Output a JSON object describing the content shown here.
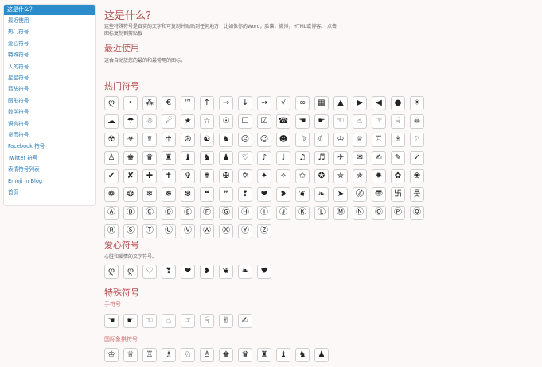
{
  "sidebar": {
    "active": "这是什么？",
    "nav": [
      "最近使用",
      "热门符号",
      "爱心符号",
      "特殊符号",
      "人的符号",
      "星星符号",
      "箭头符号",
      "图形符号",
      "数学符号",
      "语言符号",
      "货币符号"
    ],
    "social": [
      "Facebook 符号",
      "Twitter 符号",
      "表情符号列表",
      "Emoji in Blog",
      "首页"
    ]
  },
  "main": {
    "title": "这是什么？",
    "intro": [
      "这些特殊符号是真实的文字和可复制并贴贴到任何地方，比如像你的Word，脸谱，微博，HTML或博客。 点击",
      "图标复制到剪贴板"
    ],
    "recent": {
      "heading": "最近使用",
      "desc": "这会自动放您的最的和最常用的图标。"
    },
    "hot": {
      "heading": "热门符号",
      "symbols": [
        "ღ",
        "•",
        "⁂",
        "€",
        "™",
        "↑",
        "→",
        "↓",
        "⇝",
        "√",
        "∞",
        "▦",
        "▲",
        "▶",
        "◀",
        "●",
        "☀",
        "☁",
        "☂",
        "☃",
        "☄",
        "★",
        "☆",
        "☉",
        "☐",
        "☑",
        "☎",
        "☚",
        "☛",
        "☜",
        "☝",
        "☞",
        "☟",
        "☠",
        "☢",
        "☣",
        "☤",
        "☥",
        "☮",
        "☯",
        "♞",
        "☹",
        "☺",
        "☻",
        "☽",
        "☾",
        "♔",
        "♕",
        "♖",
        "♗",
        "♘",
        "♙",
        "♚",
        "♛",
        "♜",
        "♝",
        "♞",
        "♟",
        "♡",
        "♪",
        "♩",
        "♫",
        "♬",
        "✈",
        "✉",
        "✍",
        "✎",
        "✓",
        "✔",
        "✘",
        "✚",
        "✝",
        "✞",
        "✟",
        "✠",
        "✡",
        "✦",
        "✧",
        "✩",
        "✪",
        "✮",
        "✯",
        "✹",
        "✿",
        "❀",
        "❁",
        "❂",
        "❄",
        "❅",
        "❆",
        "❝",
        "❞",
        "❢",
        "❤",
        "❥",
        "❦",
        "❧",
        "➤",
        "〄",
        "〠",
        "卐",
        "웃",
        "Ⓐ",
        "Ⓑ",
        "Ⓒ",
        "Ⓓ",
        "Ⓔ",
        "Ⓕ",
        "Ⓖ",
        "Ⓗ",
        "Ⓘ",
        "Ⓙ",
        "Ⓚ",
        "Ⓛ",
        "Ⓜ",
        "Ⓝ",
        "Ⓞ",
        "Ⓟ",
        "Ⓠ",
        "Ⓡ",
        "Ⓢ",
        "Ⓣ",
        "Ⓤ",
        "Ⓥ",
        "Ⓦ",
        "Ⓧ",
        "Ⓨ",
        "Ⓩ"
      ]
    },
    "love": {
      "heading": "爱心符号",
      "desc": "心脏和爱情的文字符号。",
      "symbols": [
        "ღ",
        "ღ",
        "♡",
        "❣",
        "❤",
        "❥",
        "❦",
        "❧",
        "♥"
      ]
    },
    "special": {
      "heading": "特殊符号",
      "sub1": "手符号",
      "hands": [
        "☚",
        "☛",
        "☜",
        "☝",
        "☞",
        "☟",
        "✌",
        "✍"
      ],
      "sub2": "国际象棋符号",
      "chess": [
        "♔",
        "♕",
        "♖",
        "♗",
        "♘",
        "♙",
        "♚",
        "♛",
        "♜",
        "♝",
        "♞",
        "♟"
      ]
    }
  }
}
